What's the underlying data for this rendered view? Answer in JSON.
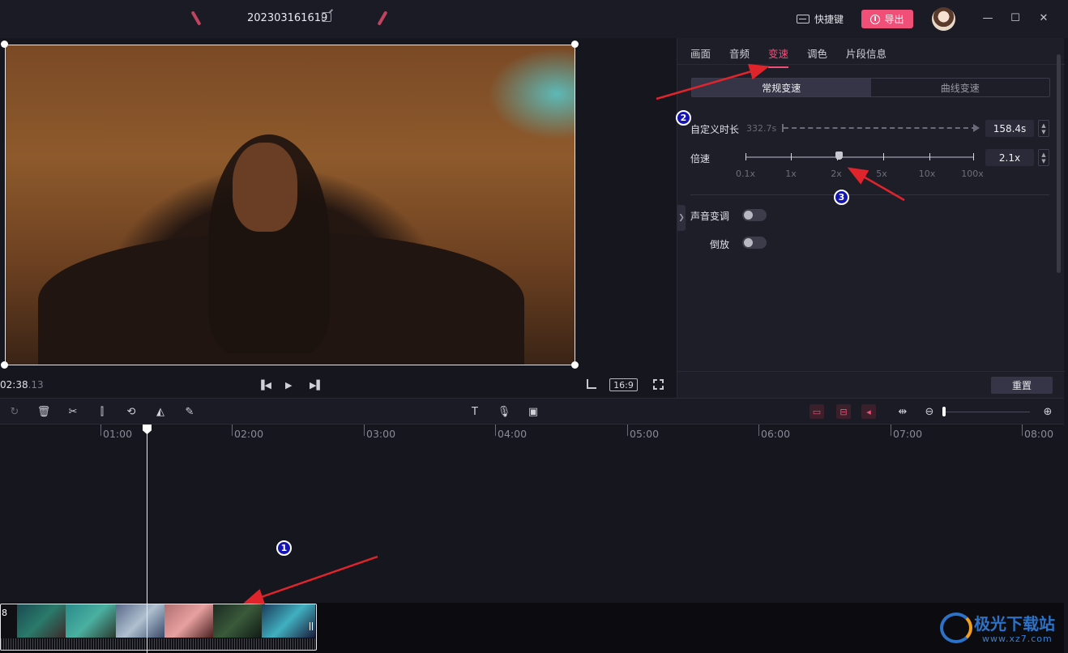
{
  "titlebar": {
    "project_title": "202303161619",
    "shortcut_label": "快捷键",
    "export_label": "导出"
  },
  "preview": {
    "timecode_main": "02:38",
    "timecode_frames": ".13",
    "aspect_ratio": "16:9"
  },
  "panel": {
    "tabs": [
      {
        "label": "画面",
        "active": false
      },
      {
        "label": "音频",
        "active": false
      },
      {
        "label": "变速",
        "active": true
      },
      {
        "label": "调色",
        "active": false
      },
      {
        "label": "片段信息",
        "active": false
      }
    ],
    "speed_modes": [
      {
        "label": "常规变速",
        "active": true
      },
      {
        "label": "曲线变速",
        "active": false
      }
    ],
    "custom_duration_label": "自定义时长",
    "original_duration": "332.7s",
    "duration_value": "158.4s",
    "speed_label": "倍速",
    "speed_value": "2.1x",
    "speed_ticks": [
      "0.1x",
      "1x",
      "2x",
      "5x",
      "10x",
      "100x"
    ],
    "pitch_label": "声音变调",
    "pitch_on": false,
    "reverse_label": "倒放",
    "reverse_on": false,
    "reset_label": "重置"
  },
  "timeline": {
    "ruler_labels": [
      "01:00",
      "02:00",
      "03:00",
      "04:00",
      "05:00",
      "06:00",
      "07:00",
      "08:00"
    ],
    "clip_label": "8"
  },
  "annotations": {
    "badges": [
      "1",
      "2",
      "3"
    ],
    "arrow_color": "#e0242c"
  },
  "watermark": {
    "title": "极光下载站",
    "url": "www.xz7.com"
  },
  "colors": {
    "accent": "#f05078",
    "background": "#16161e",
    "panel": "#1e1e29"
  }
}
